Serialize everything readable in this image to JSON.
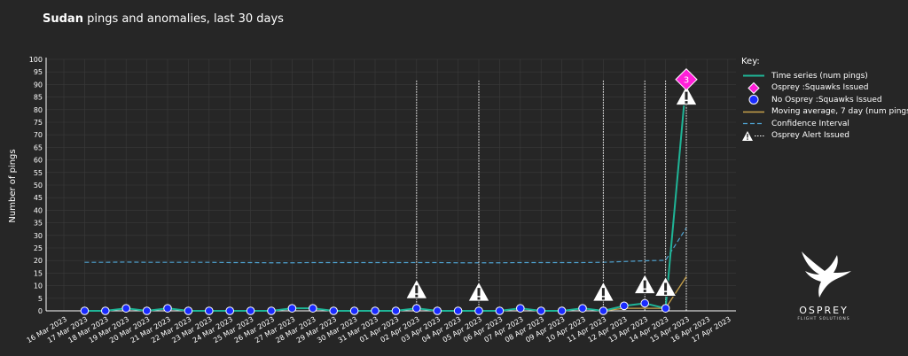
{
  "title": {
    "bold": "Sudan",
    "rest": " pings and anomalies, last 30 days"
  },
  "legend": {
    "heading": "Key:",
    "items": [
      {
        "label": "Time series (num pings)",
        "icon": "teal-line"
      },
      {
        "label": "Osprey :Squawks Issued",
        "icon": "magenta-diamond"
      },
      {
        "label": "No Osprey :Squawks Issued",
        "icon": "blue-circle"
      },
      {
        "label": "Moving average, 7 day (num pings)",
        "icon": "gold-line"
      },
      {
        "label": "Confidence Interval",
        "icon": "blue-dashed-line"
      },
      {
        "label": "Osprey Alert Issued",
        "icon": "warning-triangle-dotted"
      }
    ]
  },
  "logo": {
    "brand": "OSPREY",
    "sub": "FLIGHT SOLUTIONS"
  },
  "colors": {
    "background": "#262626",
    "grid": "#3b3b3b",
    "time_series": "#1fb597",
    "moving_avg": "#c8a24a",
    "confidence": "#4fa3d1",
    "squawk": "#ff1fd8",
    "no_squawk": "#1a2bff",
    "alert": "#ffffff"
  },
  "chart_data": {
    "type": "line",
    "ylabel": "Number of pings",
    "xlabel": "",
    "ylim": [
      0,
      100
    ],
    "yticks": [
      0,
      5,
      10,
      15,
      20,
      25,
      30,
      35,
      40,
      45,
      50,
      55,
      60,
      65,
      70,
      75,
      80,
      85,
      90,
      95,
      100
    ],
    "x_tick_labels": [
      "16 Mar 2023",
      "17 Mar 2023",
      "18 Mar 2023",
      "19 Mar 2023",
      "20 Mar 2023",
      "21 Mar 2023",
      "22 Mar 2023",
      "23 Mar 2023",
      "24 Mar 2023",
      "25 Mar 2023",
      "26 Mar 2023",
      "27 Mar 2023",
      "28 Mar 2023",
      "29 Mar 2023",
      "30 Mar 2023",
      "31 Mar 2023",
      "01 Apr 2023",
      "02 Apr 2023",
      "03 Apr 2023",
      "04 Apr 2023",
      "05 Apr 2023",
      "06 Apr 2023",
      "07 Apr 2023",
      "08 Apr 2023",
      "09 Apr 2023",
      "10 Apr 2023",
      "11 Apr 2023",
      "12 Apr 2023",
      "13 Apr 2023",
      "14 Apr 2023",
      "15 Apr 2023",
      "16 Apr 2023",
      "17 Apr 2023"
    ],
    "grid": true,
    "legend_position": "right",
    "series": [
      {
        "name": "Time series (num pings)",
        "x": [
          "17 Mar 2023",
          "18 Mar 2023",
          "19 Mar 2023",
          "20 Mar 2023",
          "21 Mar 2023",
          "22 Mar 2023",
          "23 Mar 2023",
          "24 Mar 2023",
          "25 Mar 2023",
          "26 Mar 2023",
          "27 Mar 2023",
          "28 Mar 2023",
          "29 Mar 2023",
          "30 Mar 2023",
          "31 Mar 2023",
          "01 Apr 2023",
          "02 Apr 2023",
          "03 Apr 2023",
          "04 Apr 2023",
          "05 Apr 2023",
          "06 Apr 2023",
          "07 Apr 2023",
          "08 Apr 2023",
          "09 Apr 2023",
          "10 Apr 2023",
          "11 Apr 2023",
          "12 Apr 2023",
          "13 Apr 2023",
          "14 Apr 2023",
          "15 Apr 2023"
        ],
        "values": [
          0,
          0,
          1,
          0,
          1,
          0,
          0,
          0,
          0,
          0,
          1,
          1,
          0,
          0,
          0,
          0,
          1,
          0,
          0,
          0,
          0,
          1,
          0,
          0,
          1,
          0,
          2,
          3,
          1,
          92
        ]
      },
      {
        "name": "Moving average, 7 day (num pings)",
        "x": [
          "11 Apr 2023",
          "12 Apr 2023",
          "13 Apr 2023",
          "14 Apr 2023",
          "15 Apr 2023"
        ],
        "values": [
          0,
          1,
          1,
          1,
          13.6
        ]
      },
      {
        "name": "Confidence Interval",
        "x": [
          "17 Mar 2023",
          "18 Mar 2023",
          "19 Mar 2023",
          "20 Mar 2023",
          "21 Mar 2023",
          "22 Mar 2023",
          "23 Mar 2023",
          "24 Mar 2023",
          "25 Mar 2023",
          "26 Mar 2023",
          "27 Mar 2023",
          "28 Mar 2023",
          "29 Mar 2023",
          "30 Mar 2023",
          "31 Mar 2023",
          "01 Apr 2023",
          "02 Apr 2023",
          "03 Apr 2023",
          "04 Apr 2023",
          "05 Apr 2023",
          "06 Apr 2023",
          "07 Apr 2023",
          "08 Apr 2023",
          "09 Apr 2023",
          "10 Apr 2023",
          "11 Apr 2023",
          "12 Apr 2023",
          "13 Apr 2023",
          "14 Apr 2023",
          "15 Apr 2023"
        ],
        "values": [
          19.3,
          19.3,
          19.4,
          19.3,
          19.3,
          19.3,
          19.3,
          19.2,
          19.2,
          19.1,
          19.1,
          19.2,
          19.2,
          19.2,
          19.2,
          19.2,
          19.2,
          19.2,
          19.1,
          19.1,
          19.1,
          19.2,
          19.2,
          19.2,
          19.2,
          19.3,
          19.6,
          19.9,
          20.1,
          33
        ]
      }
    ],
    "squawks": [
      {
        "x": "15 Apr 2023",
        "y": 92,
        "label": "3"
      }
    ],
    "alerts": [
      {
        "x": "02 Apr 2023",
        "y": 8
      },
      {
        "x": "05 Apr 2023",
        "y": 7
      },
      {
        "x": "11 Apr 2023",
        "y": 7
      },
      {
        "x": "13 Apr 2023",
        "y": 10
      },
      {
        "x": "14 Apr 2023",
        "y": 9
      },
      {
        "x": "15 Apr 2023",
        "y": 85
      }
    ]
  }
}
